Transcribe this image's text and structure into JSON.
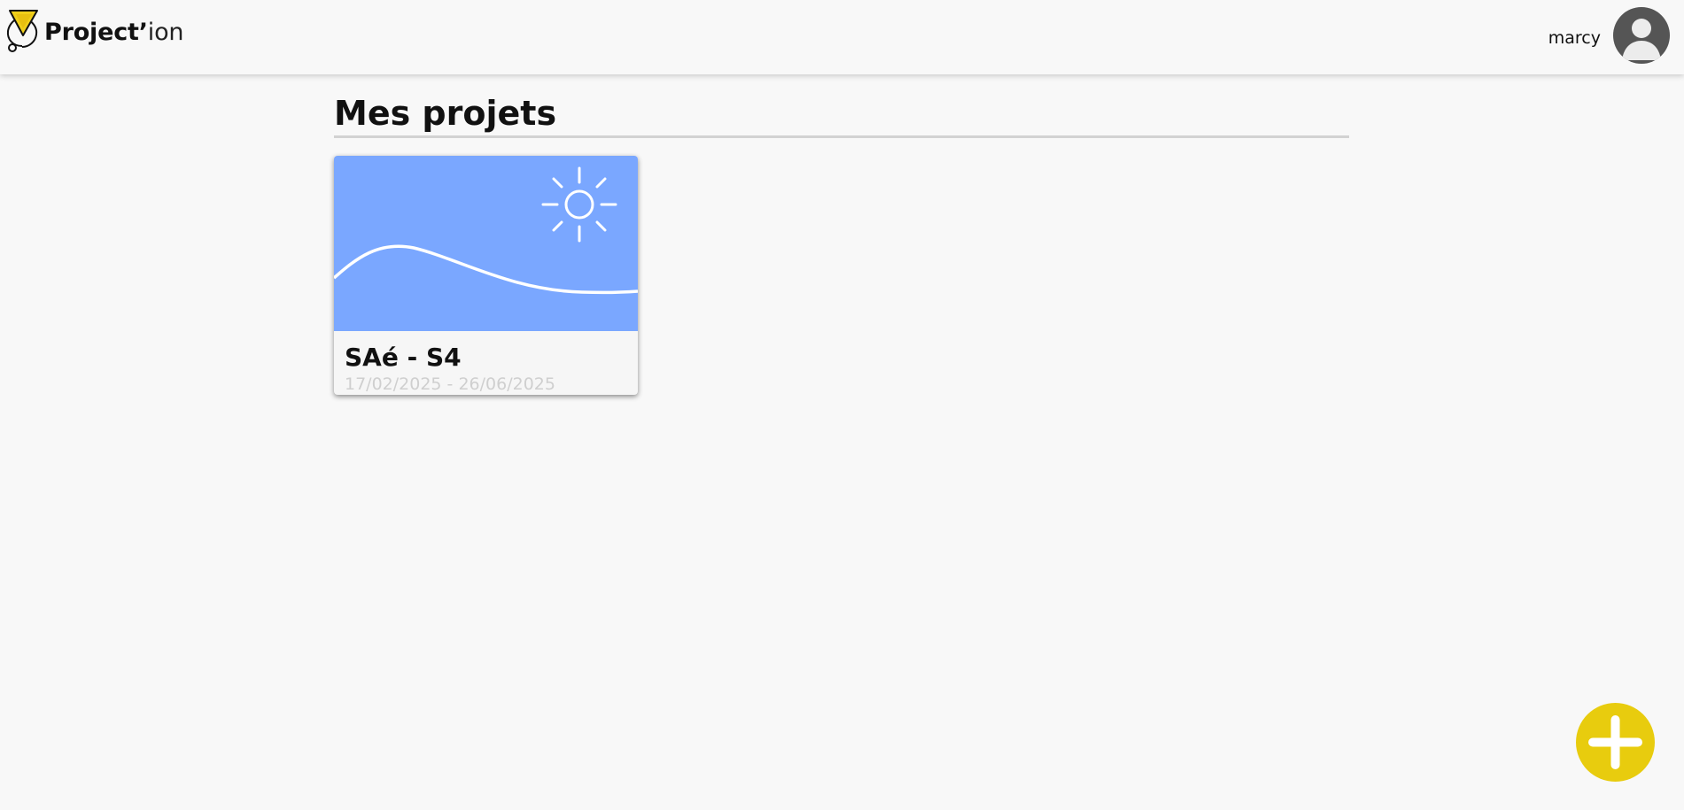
{
  "header": {
    "brand_bold": "Project’",
    "brand_light": "ion",
    "user_name": "marcy"
  },
  "main": {
    "title": "Mes projets",
    "projects": [
      {
        "name": "SAé - S4",
        "dates": "17/02/2025 - 26/06/2025",
        "banner_color": "#7aa7ff"
      }
    ]
  },
  "actions": {
    "add_button_icon": "plus-icon",
    "add_button_color": "#e8cc0e"
  },
  "icons": {
    "logo": "projection-logo-icon",
    "avatar": "user-avatar-icon",
    "banner": "sun-landscape-icon"
  }
}
